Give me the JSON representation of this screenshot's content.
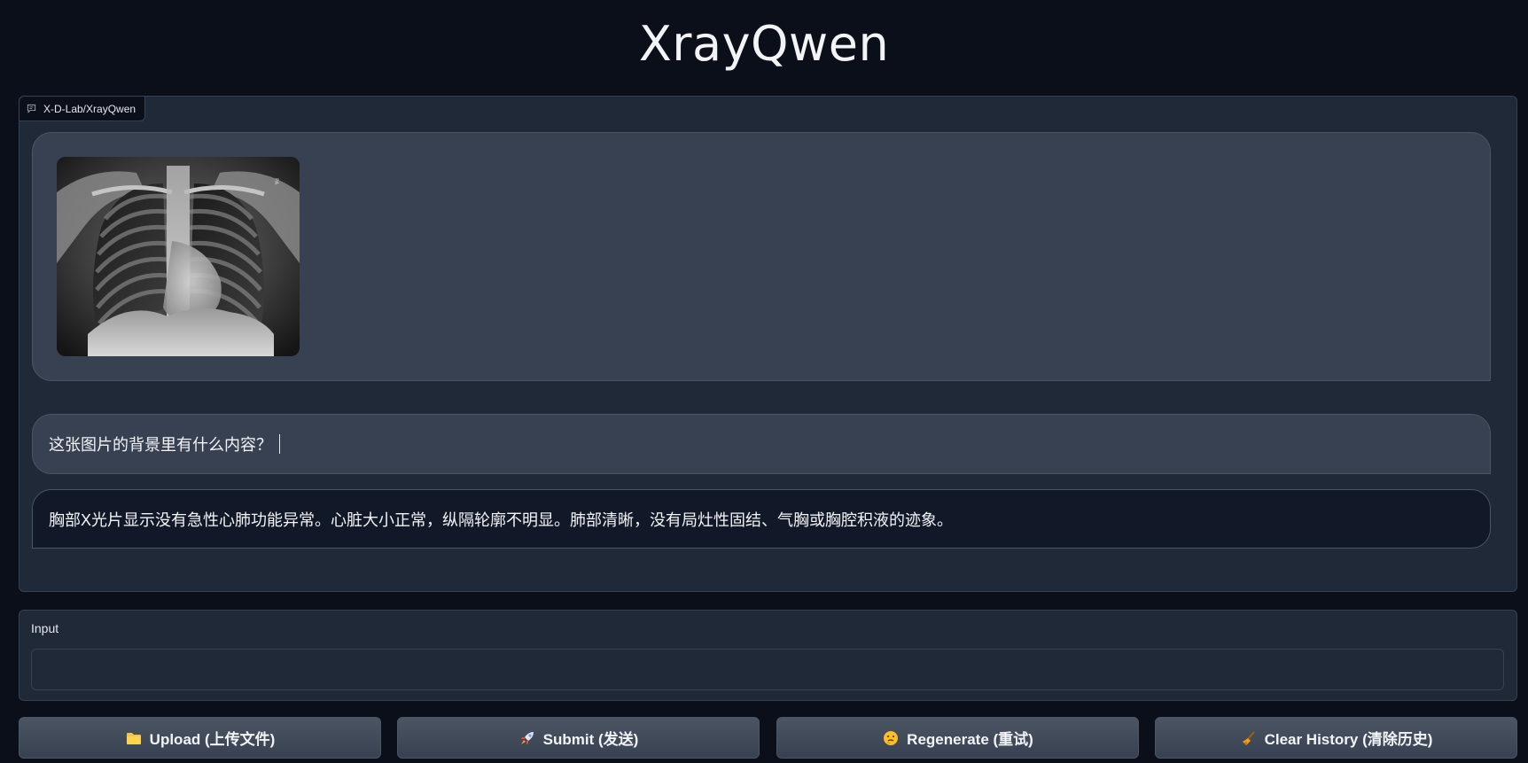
{
  "app": {
    "title": "XrayQwen"
  },
  "chatbot": {
    "label": "X-D-Lab/XrayQwen",
    "label_icon": "chat-bubble-icon",
    "messages": [
      {
        "role": "user",
        "type": "image",
        "content": "chest-xray-image"
      },
      {
        "role": "user",
        "type": "text",
        "content": "这张图片的背景里有什么内容？"
      },
      {
        "role": "bot",
        "type": "text",
        "content": "胸部X光片显示没有急性心肺功能异常。心脏大小正常，纵隔轮廓不明显。肺部清晰，没有局灶性固结、气胸或胸腔积液的迹象。"
      }
    ]
  },
  "input": {
    "label": "Input",
    "value": "",
    "placeholder": ""
  },
  "buttons": [
    {
      "label": "Upload (上传文件)",
      "icon": "folder-icon"
    },
    {
      "label": "Submit (发送)",
      "icon": "rocket-icon"
    },
    {
      "label": "Regenerate (重试)",
      "icon": "thinking-face-icon"
    },
    {
      "label": "Clear History (清除历史)",
      "icon": "broom-icon"
    }
  ],
  "colors": {
    "background": "#0b0f19",
    "panel": "#1f2937",
    "user_bubble": "#374151",
    "bot_bubble": "#111827",
    "button": "#4b5563"
  }
}
